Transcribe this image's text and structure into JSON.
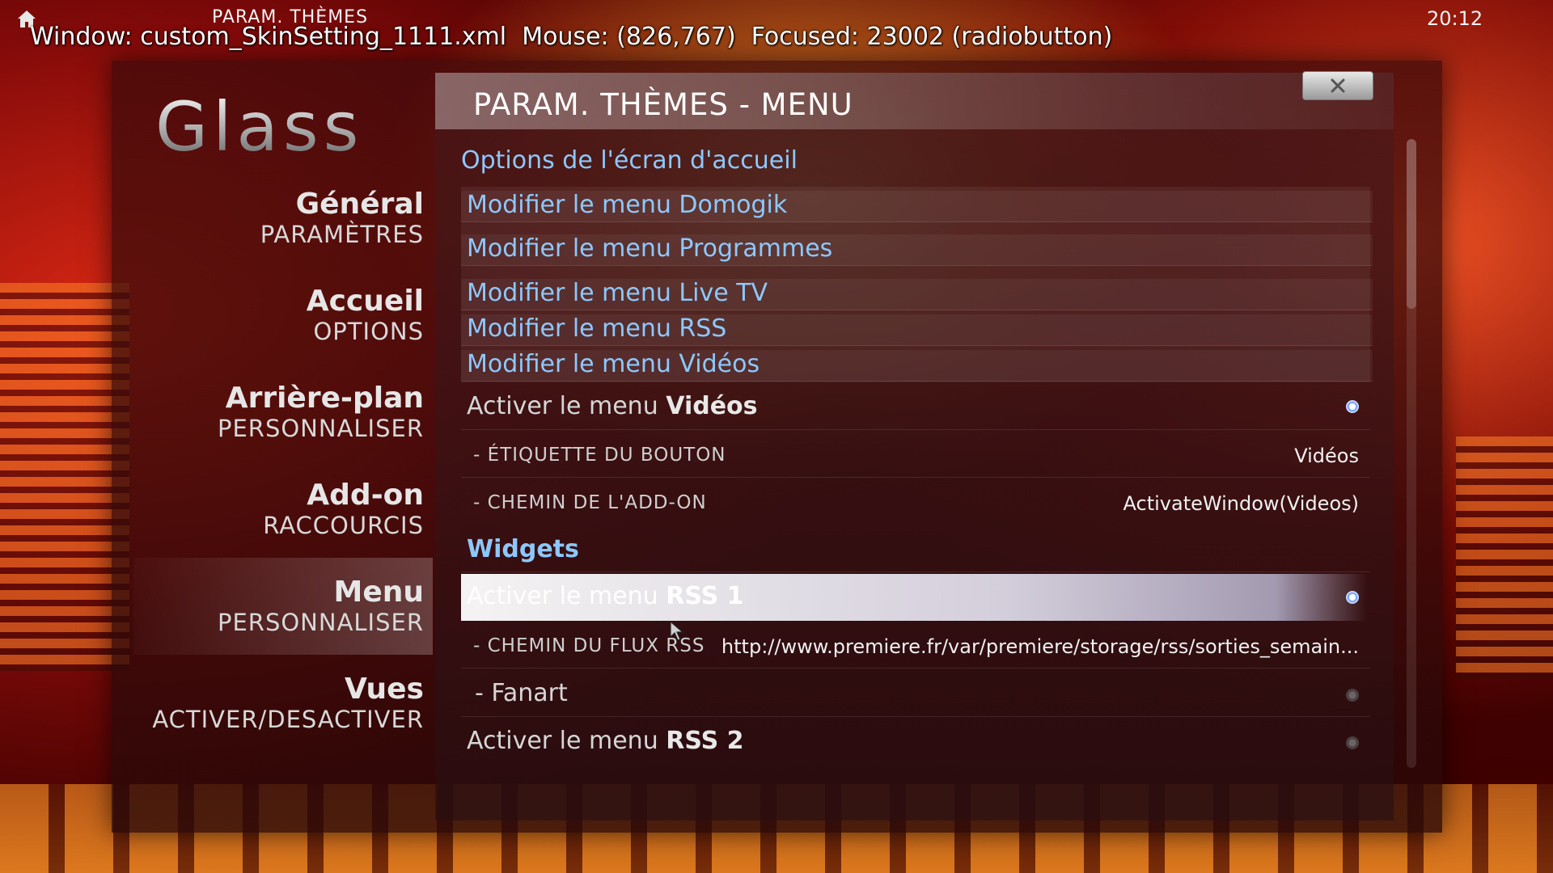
{
  "topbar": {
    "breadcrumb": "PARAM. THÈMES",
    "clock": "20:12",
    "debug": "Window: custom_SkinSetting_1111.xml  Mouse: (826,767)  Focused: 23002 (radiobutton)"
  },
  "logo": "Glass",
  "dialog": {
    "title": "PARAM. THÈMES - MENU"
  },
  "nav": [
    {
      "main": "Général",
      "sub": "PARAMÈTRES"
    },
    {
      "main": "Accueil",
      "sub": "OPTIONS"
    },
    {
      "main": "Arrière-plan",
      "sub": "PERSONNALISER"
    },
    {
      "main": "Add-on",
      "sub": "RACCOURCIS"
    },
    {
      "main": "Menu",
      "sub": "PERSONNALISER",
      "selected": true
    },
    {
      "main": "Vues",
      "sub": "ACTIVER/DESACTIVER"
    }
  ],
  "sections": {
    "home_options": "Options de l'écran d'accueil",
    "widgets": "Widgets"
  },
  "links": [
    "Modifier le menu Domogik",
    "Modifier le menu Programmes",
    "Modifier le menu Live TV",
    "Modifier le menu RSS",
    "Modifier le menu Vidéos"
  ],
  "videos": {
    "prefix": "Activer le menu ",
    "bold": "Vidéos",
    "enabled": true,
    "label_label": "- ÉTIQUETTE DU BOUTON",
    "label_value": "Vidéos",
    "path_label": "- CHEMIN DE L'ADD-ON",
    "path_value": "ActivateWindow(Videos)"
  },
  "rss1": {
    "prefix": "Activer le menu ",
    "bold": "RSS 1",
    "enabled": true,
    "feed_label": "- CHEMIN DU FLUX RSS",
    "feed_value": "http://www.premiere.fr/var/premiere/storage/rss/sorties_semain...",
    "fanart_label": "- Fanart",
    "fanart_enabled": false
  },
  "rss2": {
    "prefix": "Activer le menu ",
    "bold": "RSS 2",
    "enabled": false
  },
  "colors": {
    "accent": "#8cc8ff",
    "radio_on": "#7aa8ff"
  }
}
